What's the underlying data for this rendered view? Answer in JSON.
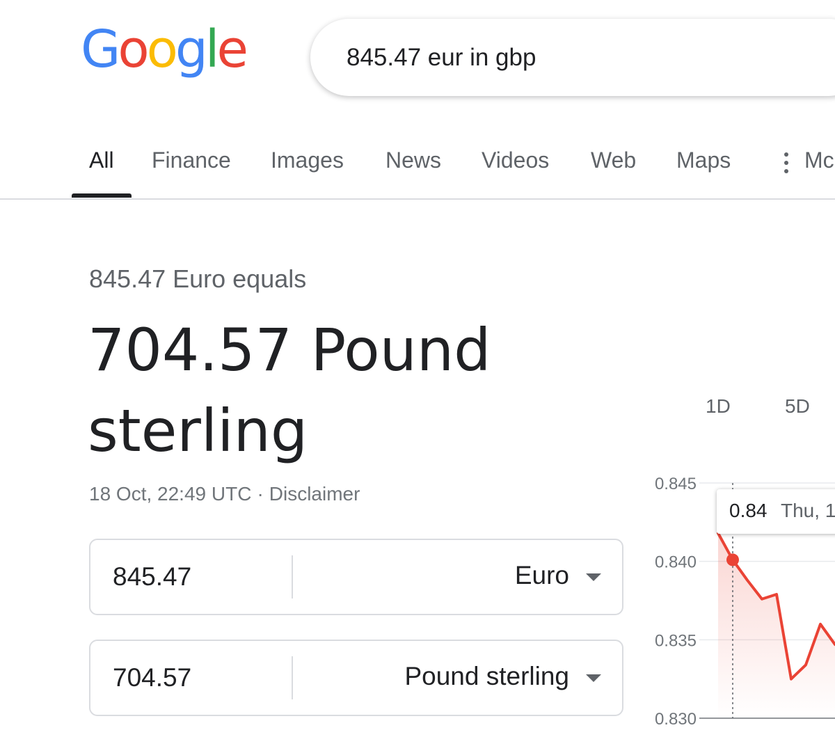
{
  "header": {
    "logo_text": "Google",
    "logo_letters": [
      "G",
      "o",
      "o",
      "g",
      "l",
      "e"
    ],
    "logo_colors": [
      "#4285F4",
      "#EA4335",
      "#FBBC05",
      "#4285F4",
      "#34A853",
      "#EA4335"
    ],
    "search_value": "845.47 eur in gbp"
  },
  "tabs": {
    "items": [
      "All",
      "Finance",
      "Images",
      "News",
      "Videos",
      "Web",
      "Maps",
      "Mc"
    ],
    "active": "All"
  },
  "result": {
    "equals_text": "845.47 Euro equals",
    "value_text": "704.57 Pound sterling",
    "timestamp": "18 Oct, 22:49 UTC",
    "separator": "·",
    "disclaimer": "Disclaimer"
  },
  "converter": {
    "from": {
      "amount": "845.47",
      "unit": "Euro"
    },
    "to": {
      "amount": "704.57",
      "unit": "Pound sterling"
    }
  },
  "chart_ranges": [
    "1D",
    "5D"
  ],
  "tooltip": {
    "value": "0.84",
    "date": "Thu, 1"
  },
  "colors": {
    "line": "#EA4335",
    "accent_text": "#202124",
    "muted_text": "#5f6368",
    "border": "#dadce0"
  },
  "chart_data": {
    "type": "line",
    "title": "",
    "xlabel": "",
    "ylabel": "",
    "ylim": [
      0.83,
      0.845
    ],
    "yticks": [
      "0.845",
      "0.840",
      "0.835",
      "0.830"
    ],
    "ytick_values": [
      0.845,
      0.84,
      0.835,
      0.83
    ],
    "grid": true,
    "highlighted_point": {
      "index": 1,
      "value": 0.8401
    },
    "series": [
      {
        "values": [
          0.8418,
          0.8401,
          0.8388,
          0.8376,
          0.8379,
          0.8325,
          0.8334,
          0.836,
          0.8347
        ]
      }
    ]
  }
}
